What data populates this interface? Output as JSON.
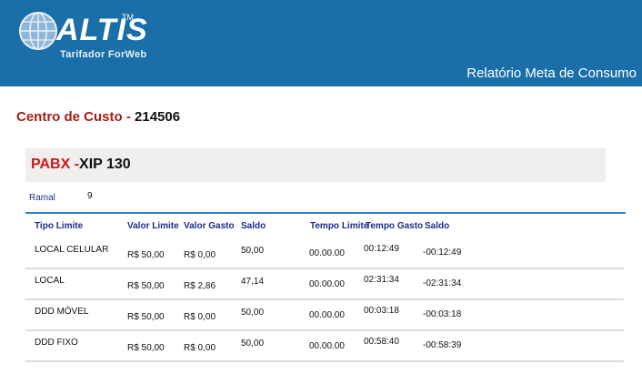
{
  "header": {
    "brand": "ALTIS",
    "trademark": "TM",
    "tagline": "Tarifador ForWeb",
    "report_title": "Relatório Meta de Consumo",
    "background_color": "#1b6fa8"
  },
  "cost_center": {
    "label": "Centro de Custo",
    "separator": " - ",
    "value": "214506"
  },
  "pabx": {
    "label": "PABX",
    "separator": " -",
    "value": "XIP 130"
  },
  "ramal": {
    "label": "Ramal",
    "value": "9"
  },
  "table": {
    "columns": [
      "Tipo Limite",
      "Valor Limite",
      "Valor Gasto",
      "Saldo",
      "Tempo Limite",
      "Tempo Gasto",
      "Saldo"
    ],
    "rows": [
      [
        "LOCAL CELULAR",
        "R$ 50,00",
        "R$ 0,00",
        "50,00",
        "00.00.00",
        "00:12:49",
        "-00:12:49"
      ],
      [
        "LOCAL",
        "R$ 50,00",
        "R$ 2,86",
        "47,14",
        "00.00.00",
        "02:31:34",
        "-02:31:34"
      ],
      [
        "DDD MÓVEL",
        "R$ 50,00",
        "R$ 0,00",
        "50,00",
        "00.00.00",
        "00:03:18",
        "-00:03:18"
      ],
      [
        "DDD FIXO",
        "R$ 50,00",
        "R$ 0,00",
        "50,00",
        "00.00.00",
        "00:58:40",
        "-00:58:39"
      ]
    ]
  },
  "colors": {
    "accent_red": "#a61c16",
    "header_text_blue": "#1d2c8a",
    "rule_blue": "#2d86c2"
  }
}
